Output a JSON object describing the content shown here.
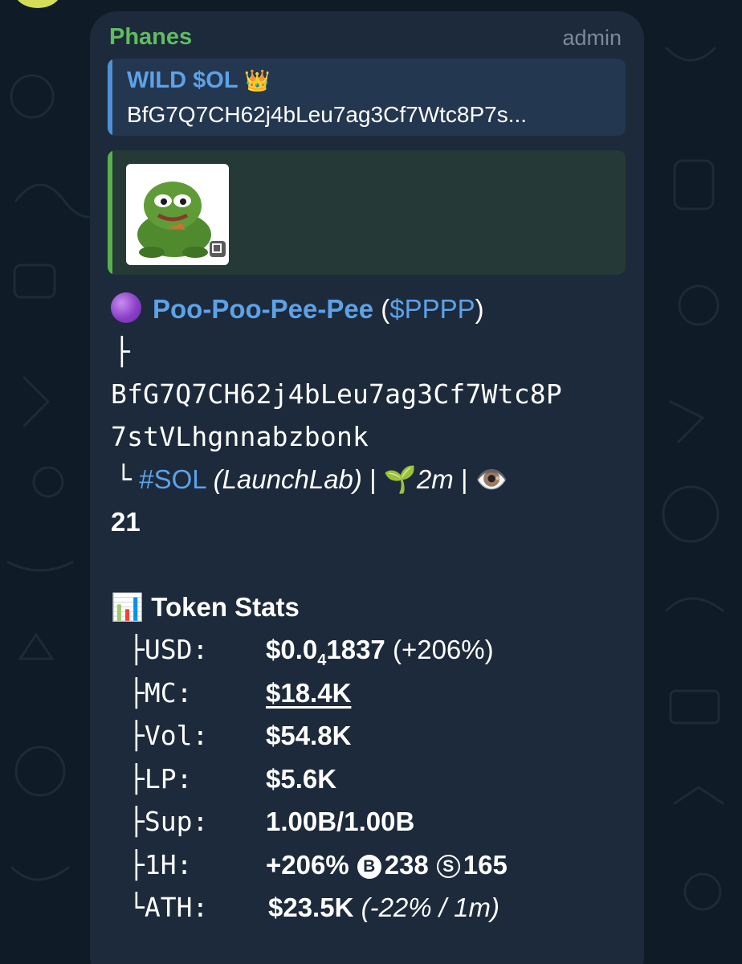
{
  "message": {
    "sender": "Phanes",
    "role": "admin",
    "reply": {
      "title": "WILD $OL",
      "title_icon": "crown-icon",
      "text": "BfG7Q7CH62j4bLeu7ag3Cf7Wtc8P7s..."
    },
    "token": {
      "status_icon": "purple-circle-icon",
      "name": "Poo-Poo-Pee-Pee",
      "ticker_open": "(",
      "ticker": "$PPPP",
      "ticker_close": ")",
      "branch_top": "├",
      "address_line1": "BfG7Q7CH62j4bLeu7ag3Cf7Wtc8P",
      "address_line2": "7stVLhgnnabzbonk",
      "branch_last": "└",
      "chain_tag": "#SOL",
      "launchpad": "(LaunchLab)",
      "sep": "|",
      "age_icon": "seedling-icon",
      "age": "2m",
      "views_icon": "eye-icon",
      "views": "21"
    },
    "stats": {
      "header_icon": "bar-chart-icon",
      "header": "Token Stats",
      "usd_label": "├USD:",
      "usd_main": "$0.0",
      "usd_sub": "4",
      "usd_tail": "1837",
      "usd_change": "(+206%)",
      "mc_label": "├MC:",
      "mc_value": "$18.4K",
      "vol_label": "├Vol:",
      "vol_value": "$54.8K",
      "lp_label": "├LP:",
      "lp_value": "$5.6K",
      "sup_label": "├Sup:",
      "sup_value": "1.00B/1.00B",
      "h1_label": "├1H:",
      "h1_change": "+206%",
      "h1_buys_icon": "B",
      "h1_buys": "238",
      "h1_sells_icon": "S",
      "h1_sells": "165",
      "ath_label": "└ATH:",
      "ath_value": "$23.5K",
      "ath_detail": "(-22% / 1m)"
    }
  },
  "colors": {
    "background": "#0f1b26",
    "bubble": "#1d2a3b",
    "sender": "#5fbd5e",
    "link": "#5da2e8",
    "reply_bar": "#4c91d6",
    "preview_bar": "#58b24a"
  }
}
